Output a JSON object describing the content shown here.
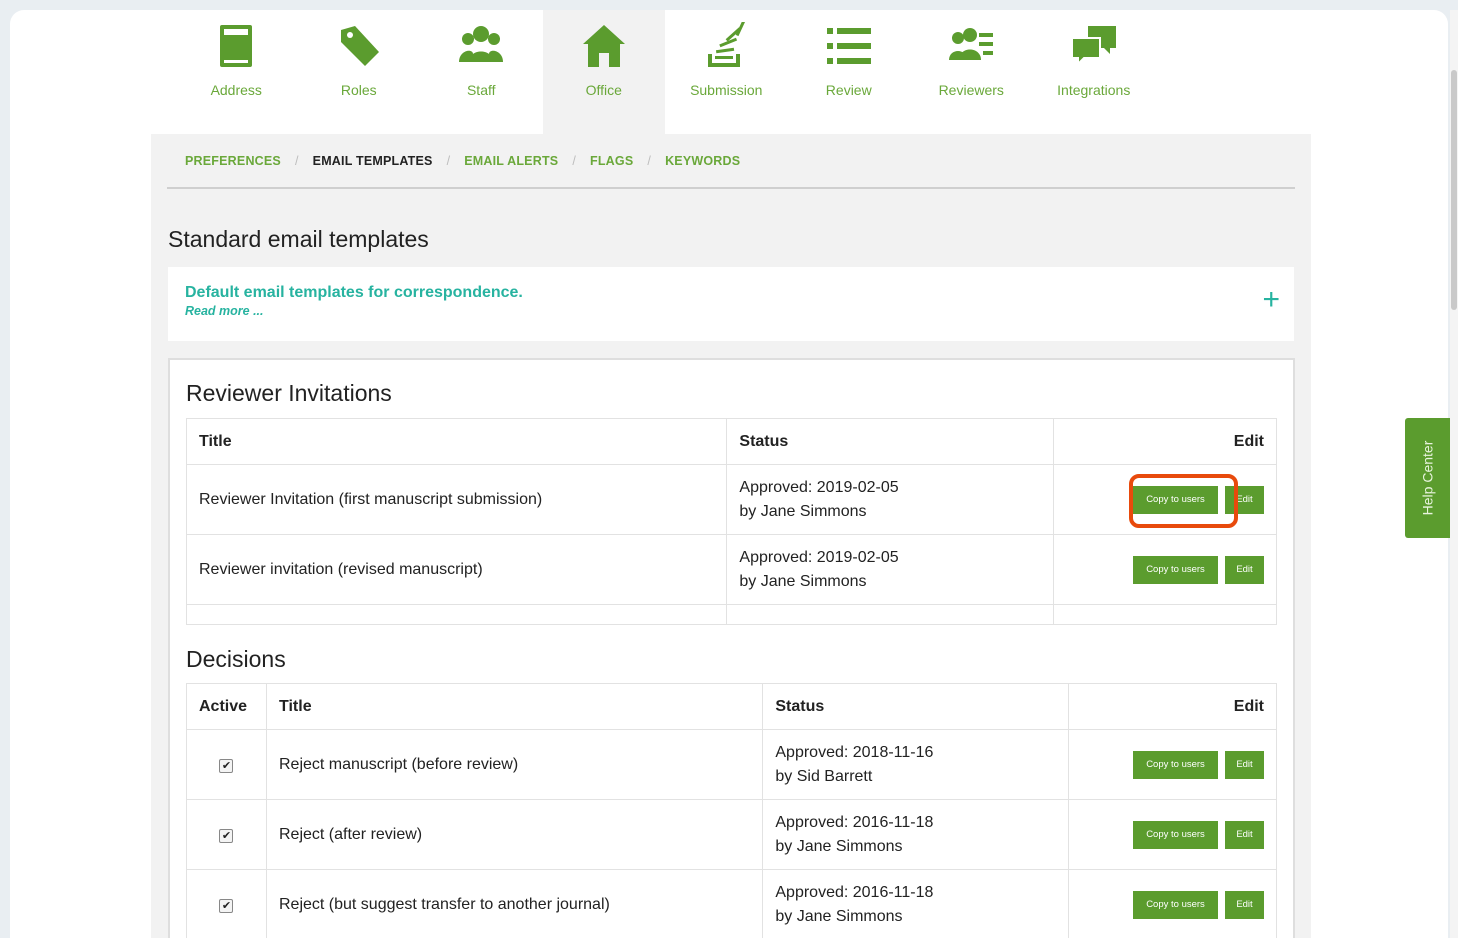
{
  "colors": {
    "accent": "#5b9c2e",
    "teal": "#27b3a0",
    "highlight": "#e84a0c"
  },
  "nav": [
    {
      "label": "Address",
      "icon": "address-book-icon"
    },
    {
      "label": "Roles",
      "icon": "tag-icon"
    },
    {
      "label": "Staff",
      "icon": "group-icon"
    },
    {
      "label": "Office",
      "icon": "home-icon",
      "active": true
    },
    {
      "label": "Submission",
      "icon": "submission-icon"
    },
    {
      "label": "Review",
      "icon": "list-icon"
    },
    {
      "label": "Reviewers",
      "icon": "reviewers-icon"
    },
    {
      "label": "Integrations",
      "icon": "chat-icon"
    }
  ],
  "breadcrumb": [
    "PREFERENCES",
    "EMAIL TEMPLATES",
    "EMAIL ALERTS",
    "FLAGS",
    "KEYWORDS"
  ],
  "section_title": "Standard email templates",
  "info": {
    "title": "Default email templates for correspondence.",
    "more": "Read more ...",
    "expand": "+"
  },
  "reviewer_invitations": {
    "heading": "Reviewer Invitations",
    "columns": {
      "title": "Title",
      "status": "Status",
      "edit": "Edit"
    },
    "rows": [
      {
        "title": "Reviewer Invitation (first manuscript submission)",
        "status": "Approved: 2019-02-05",
        "by": "by Jane Simmons",
        "copy": "Copy to users",
        "edit": "Edit"
      },
      {
        "title": "Reviewer invitation (revised manuscript)",
        "status": "Approved: 2019-02-05",
        "by": "by Jane Simmons",
        "copy": "Copy to users",
        "edit": "Edit"
      }
    ]
  },
  "decisions": {
    "heading": "Decisions",
    "columns": {
      "active": "Active",
      "title": "Title",
      "status": "Status",
      "edit": "Edit"
    },
    "rows": [
      {
        "title": "Reject manuscript (before review)",
        "status": "Approved: 2018-11-16",
        "by": "by Sid Barrett",
        "copy": "Copy to users",
        "edit": "Edit",
        "active": true
      },
      {
        "title": "Reject (after review)",
        "status": "Approved: 2016-11-18",
        "by": "by Jane Simmons",
        "copy": "Copy to users",
        "edit": "Edit",
        "active": true
      },
      {
        "title": "Reject (but suggest transfer to another journal)",
        "status": "Approved: 2016-11-18",
        "by": "by Jane Simmons",
        "copy": "Copy to users",
        "edit": "Edit",
        "active": true
      }
    ]
  },
  "help_center": "Help Center"
}
